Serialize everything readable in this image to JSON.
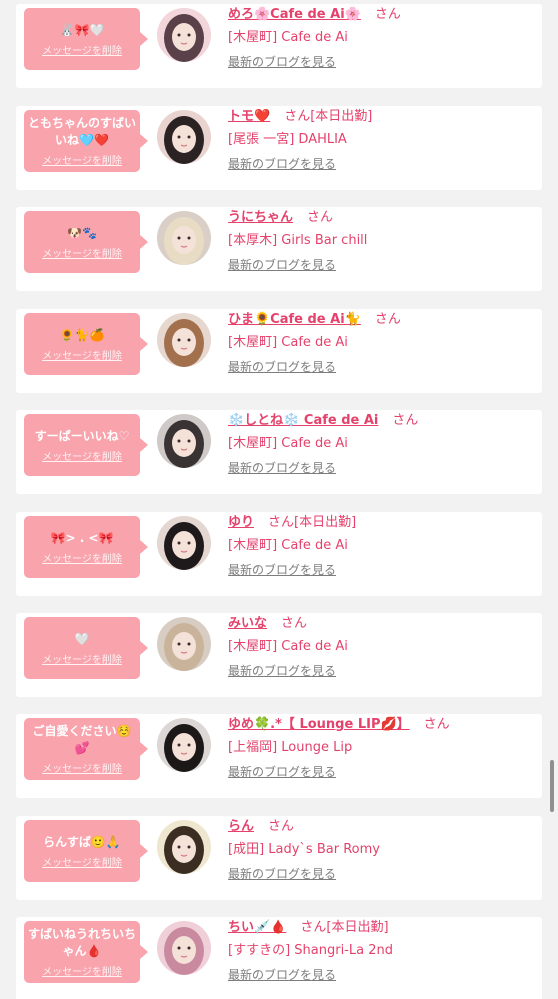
{
  "delete_label": "メッセージを削除",
  "blog_label": "最新のブログを見る",
  "san_label": "さん",
  "colors": {
    "accent_pink": "#e4426b",
    "bubble_pink": "#f9a3ad",
    "card_bg": "#ffffff",
    "page_bg": "#f2f2f2",
    "link_gray": "#7d7d7d"
  },
  "entries": [
    {
      "message": "🐰🎀🤍",
      "name": "めろ🌸Cafe de Ai🌸",
      "suffix": "",
      "shop": "[木屋町] Cafe de Ai",
      "avatar_bg": "#f3d5dc",
      "avatar_hair": "#5a4048"
    },
    {
      "message": "ともちゃんのすばいいね🩵❤️",
      "name": "トモ❤️",
      "suffix": "[本日出勤]",
      "shop": "[尾張 一宮] DAHLIA",
      "avatar_bg": "#e9d3cf",
      "avatar_hair": "#2b2223"
    },
    {
      "message": "🐶🐾",
      "name": "うにちゃん",
      "suffix": "",
      "shop": "[本厚木] Girls Bar chill",
      "avatar_bg": "#d9cfc6",
      "avatar_hair": "#e8dcc4"
    },
    {
      "message": "🌻🐈🍊",
      "name": "ひま🌻Cafe de Ai🐈",
      "suffix": "",
      "shop": "[木屋町] Cafe de Ai",
      "avatar_bg": "#e6d8cf",
      "avatar_hair": "#a3704d"
    },
    {
      "message": "すーぱーいいね♡",
      "name": "❄️しとね❄️ Cafe de Ai",
      "suffix": "",
      "shop": "[木屋町] Cafe de Ai",
      "avatar_bg": "#cfc9c7",
      "avatar_hair": "#3a3333"
    },
    {
      "message": "🎀> . <🎀",
      "name": "ゆり",
      "suffix": "[本日出勤]",
      "shop": "[木屋町] Cafe de Ai",
      "avatar_bg": "#e4d6d1",
      "avatar_hair": "#1e1a1b"
    },
    {
      "message": "🤍",
      "name": "みいな",
      "suffix": "",
      "shop": "[木屋町] Cafe de Ai",
      "avatar_bg": "#d8cdc2",
      "avatar_hair": "#c9b49b"
    },
    {
      "message": "ご自愛ください☺️💕",
      "name": "ゆめ🍀.*【 Lounge LIP💋】",
      "suffix": "",
      "shop": "[上福岡] Lounge Lip",
      "avatar_bg": "#dcd7d5",
      "avatar_hair": "#1c1818"
    },
    {
      "message": "らんすば🙂🙏",
      "name": "らん",
      "suffix": "",
      "shop": "[成田] Lady`s Bar Romy",
      "avatar_bg": "#efe6cf",
      "avatar_hair": "#3b2d22"
    },
    {
      "message": "すばいねうれちいちゃん🩸",
      "name": "ちい💉🩸",
      "suffix": "[本日出勤]",
      "shop": "[すすきの] Shangri-La 2nd",
      "avatar_bg": "#f0d0d8",
      "avatar_hair": "#c98aa0"
    }
  ]
}
